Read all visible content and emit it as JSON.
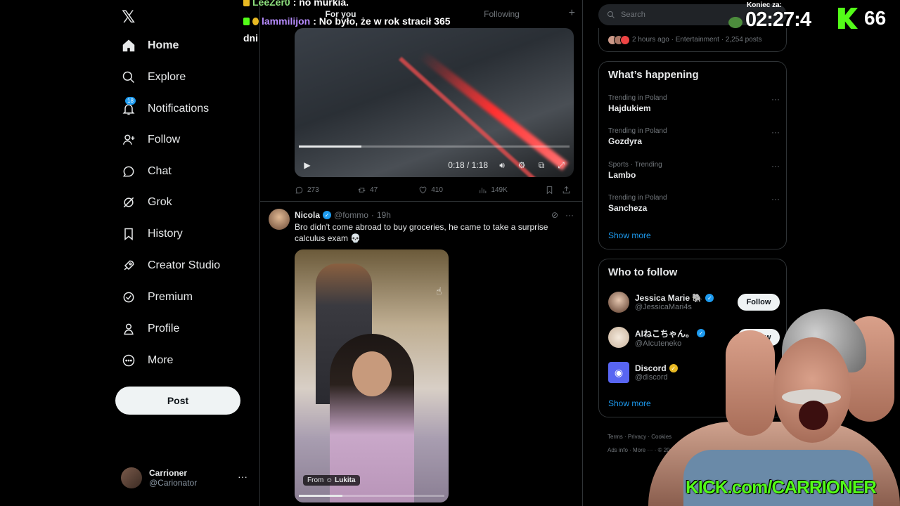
{
  "nav": {
    "items": [
      {
        "label": "Home",
        "icon": "home-icon"
      },
      {
        "label": "Explore",
        "icon": "search-icon"
      },
      {
        "label": "Notifications",
        "icon": "bell-icon",
        "badge": "18"
      },
      {
        "label": "Follow",
        "icon": "add-user-icon"
      },
      {
        "label": "Chat",
        "icon": "chat-icon"
      },
      {
        "label": "Grok",
        "icon": "grok-icon"
      },
      {
        "label": "History",
        "icon": "bookmark-icon"
      },
      {
        "label": "Creator Studio",
        "icon": "rocket-icon"
      },
      {
        "label": "Premium",
        "icon": "verified-icon"
      },
      {
        "label": "Profile",
        "icon": "person-icon"
      },
      {
        "label": "More",
        "icon": "more-circle-icon"
      }
    ],
    "post_label": "Post",
    "account": {
      "name": "Carrioner",
      "handle": "@Carionator",
      "more": "···"
    }
  },
  "tabs": {
    "for_you": "For you",
    "following": "Following",
    "plus": "+"
  },
  "video1": {
    "time": "0:18 / 1:18"
  },
  "actions1": {
    "replies": "273",
    "reposts": "47",
    "likes": "410",
    "views": "149K"
  },
  "tweet2": {
    "name": "Nicola",
    "handle": "@fommo",
    "sep": "·",
    "time": "19h",
    "text": "Bro didn't come abroad to buy groceries, he came to take a surprise calculus exam 💀",
    "from_prefix": "From",
    "from_name": "Lukita"
  },
  "right": {
    "search_placeholder": "Search",
    "live_meta": "2 hours ago · Entertainment · 2,254 posts",
    "happening_title": "What’s happening",
    "trends": [
      {
        "meta": "Trending in Poland",
        "name": "Hajdukiem"
      },
      {
        "meta": "Trending in Poland",
        "name": "Gozdyra"
      },
      {
        "meta": "Sports · Trending",
        "name": "Lambo"
      },
      {
        "meta": "Trending in Poland",
        "name": "Sancheza"
      }
    ],
    "show_more": "Show more",
    "who_title": "Who to follow",
    "who": [
      {
        "name": "Jessica Marie 🐘",
        "handle": "@JessicaMari4s",
        "badge": "blue"
      },
      {
        "name": "AIねこちゃん。",
        "handle": "@AIcuteneko",
        "badge": "blue"
      },
      {
        "name": "Discord",
        "handle": "@discord",
        "badge": "gold"
      }
    ],
    "follow_label": "Follow",
    "footer": {
      "l1a": "Terms",
      "l1b": "Privacy",
      "l1c": "Cookies",
      "l2a": "Ads info",
      "l2b": "More ···",
      "l2c": "© 20"
    }
  },
  "overlay": {
    "chat": [
      {
        "user": "LeeZer0",
        "msg": ": no murkia."
      },
      {
        "user": "lammilijon",
        "msg": ": No było, że w rok stracił 365"
      },
      {
        "user": "",
        "msg": "dni"
      }
    ],
    "timer_label": "Koniec za:",
    "timer": "02:27:4",
    "kick_count": "66",
    "banner": "KICK.com/CARRIONER"
  },
  "colors": {
    "accent": "#1d9bf0",
    "kick_green": "#53fc18",
    "bg": "#000000",
    "border": "#2f3336"
  }
}
